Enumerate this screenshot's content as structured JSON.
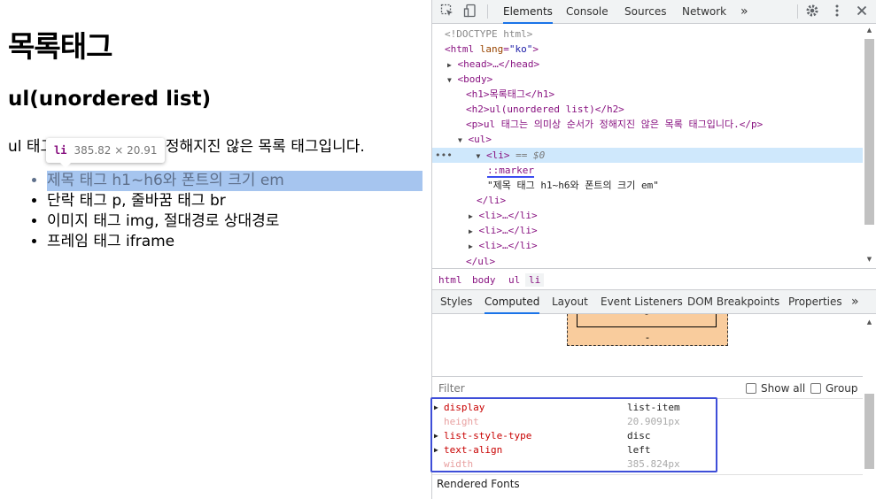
{
  "page": {
    "h1": "목록태그",
    "h2": "ul(unordered list)",
    "paragraph": "ul 태그는 의미상 순서가 정해지진 않은 목록 태그입니다.",
    "list_items": [
      "제목 태그 h1~h6와 폰트의 크기 em",
      "단락 태그 p, 줄바꿈 태그 br",
      "이미지 태그 img, 절대경로 상대경로",
      "프레임 태그 iframe"
    ],
    "tooltip": {
      "tag": "li",
      "size": "385.82 × 20.91"
    }
  },
  "devtools": {
    "toolbar_icons": [
      "inspect-icon",
      "device-toolbar-icon",
      "settings-icon",
      "kebab-menu-icon",
      "close-icon"
    ],
    "tabs": [
      "Elements",
      "Console",
      "Sources",
      "Network",
      "»"
    ],
    "active_tab": "Elements",
    "dom": {
      "doctype": "<!DOCTYPE html>",
      "html_open_tag": "<html",
      "html_attr_name": "lang",
      "html_attr_value": "\"ko\"",
      "html_close_bracket": ">",
      "head": "<head>…</head>",
      "body_open": "<body>",
      "h1": "<h1>목록태그</h1>",
      "h2": "<h2>ul(unordered list)</h2>",
      "p": "<p>ul 태그는 의미상 순서가 정해지진 않은 목록 태그입니다.</p>",
      "ul_open": "<ul>",
      "li_open": "<li>",
      "li_eq": "== $0",
      "dots": "•••",
      "marker": "::marker",
      "li_text": "\"제목 태그 h1~h6와 폰트의 크기 em\"",
      "li_close": "</li>",
      "li_collapsed": "<li>…</li>",
      "ul_close": "</ul>"
    },
    "breadcrumbs": [
      "html",
      "body",
      "ul",
      "li"
    ],
    "subtabs": [
      "Styles",
      "Computed",
      "Layout",
      "Event Listeners",
      "DOM Breakpoints",
      "Properties",
      "»"
    ],
    "active_subtab": "Computed",
    "boxmodel": {
      "top": "-",
      "bottom": "-"
    },
    "filter": {
      "placeholder": "Filter",
      "show_all": "Show all",
      "group": "Group"
    },
    "computed": [
      {
        "name": "display",
        "value": "list-item",
        "expandable": true,
        "faded": false
      },
      {
        "name": "height",
        "value": "20.9091px",
        "expandable": false,
        "faded": true
      },
      {
        "name": "list-style-type",
        "value": "disc",
        "expandable": true,
        "faded": false
      },
      {
        "name": "text-align",
        "value": "left",
        "expandable": true,
        "faded": false
      },
      {
        "name": "width",
        "value": "385.824px",
        "expandable": false,
        "faded": true
      }
    ],
    "rendered_fonts": "Rendered Fonts",
    "colors": {
      "highlight_box": "#3e4ed8",
      "selection": "#cfe8fc",
      "li_highlight": "#a6c5ef",
      "accent": "#1a73e8"
    }
  }
}
